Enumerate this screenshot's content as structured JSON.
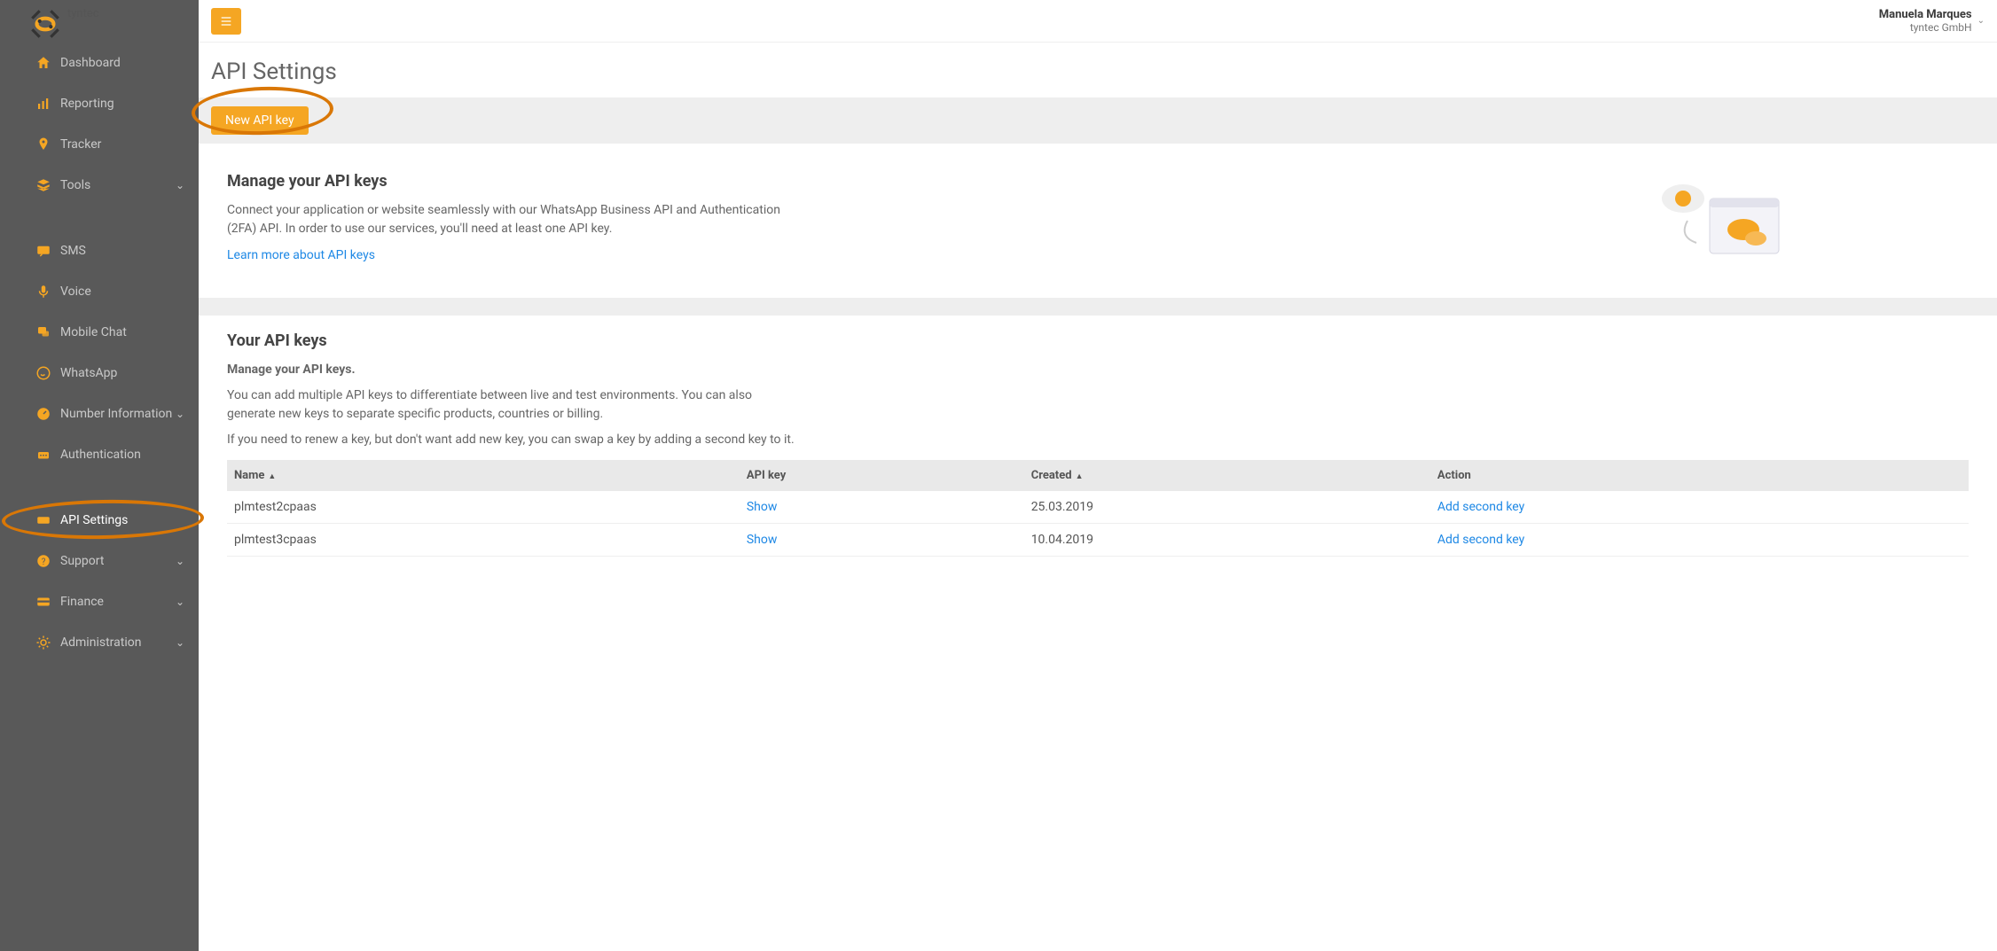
{
  "brand": {
    "name": "tyntec"
  },
  "user": {
    "name": "Manuela Marques",
    "company": "tyntec GmbH"
  },
  "sidebar": {
    "group1": [
      {
        "label": "Dashboard",
        "icon": "home"
      },
      {
        "label": "Reporting",
        "icon": "bars"
      },
      {
        "label": "Tracker",
        "icon": "pin"
      },
      {
        "label": "Tools",
        "icon": "stack",
        "chevron": true
      }
    ],
    "group2": [
      {
        "label": "SMS",
        "icon": "sms"
      },
      {
        "label": "Voice",
        "icon": "mic"
      },
      {
        "label": "Mobile Chat",
        "icon": "chat-mobile"
      },
      {
        "label": "WhatsApp",
        "icon": "whatsapp"
      },
      {
        "label": "Number Information",
        "icon": "gauge",
        "chevron": true
      },
      {
        "label": "Authentication",
        "icon": "auth"
      }
    ],
    "group3": [
      {
        "label": "API Settings",
        "icon": "api",
        "active": true,
        "circled": true
      },
      {
        "label": "Support",
        "icon": "support",
        "chevron": true
      },
      {
        "label": "Finance",
        "icon": "card",
        "chevron": true
      },
      {
        "label": "Administration",
        "icon": "gear",
        "chevron": true
      }
    ]
  },
  "page": {
    "title": "API Settings",
    "new_key_button": "New API key",
    "manage": {
      "heading": "Manage your API keys",
      "body": "Connect your application or website seamlessly with our WhatsApp Business API and Authentication (2FA) API. In order to use our services, you'll need at least one API key.",
      "learn_more": "Learn more about API keys"
    },
    "your_keys": {
      "heading": "Your API keys",
      "sub_bold": "Manage your API keys.",
      "para1": "You can add multiple API keys to differentiate between live and test environments. You can also generate new keys to separate specific products, countries or billing.",
      "para2": "If you need to renew a key, but don't want add new key, you can swap a key by adding a second key to it.",
      "columns": {
        "name": "Name",
        "apikey": "API key",
        "created": "Created",
        "action": "Action"
      },
      "show_label": "Show",
      "add_second_label": "Add second key",
      "rows": [
        {
          "name": "plmtest2cpaas",
          "created": "25.03.2019"
        },
        {
          "name": "plmtest3cpaas",
          "created": "10.04.2019"
        }
      ]
    }
  }
}
